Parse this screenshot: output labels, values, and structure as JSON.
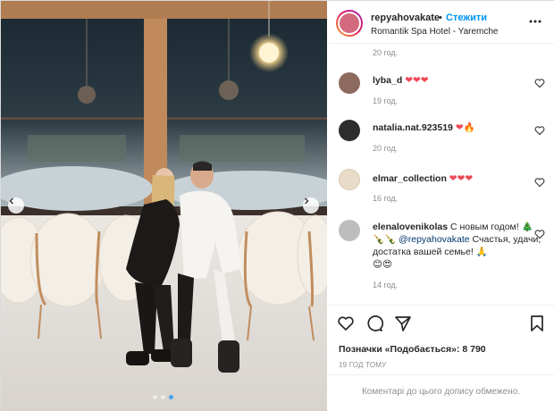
{
  "header": {
    "username": "repyahovakate",
    "separator": "•",
    "follow_label": "Стежити",
    "location": "Romantik Spa Hotel - Yaremche"
  },
  "comments": {
    "top_time": "20 год.",
    "items": [
      {
        "username": "lyba_d",
        "text": "❤❤❤",
        "time": "19 год.",
        "avatar_color": "#8c6a5e"
      },
      {
        "username": "natalia.nat.923519",
        "text": "❤🔥",
        "time": "20 год.",
        "avatar_color": "#2d2d2d"
      },
      {
        "username": "elmar_collection",
        "text": "❤❤❤",
        "time": "16 год.",
        "avatar_color": "#e8dcc9"
      },
      {
        "username": "elenalovenikolas",
        "text_1": "С новым годом!",
        "emoji_line": "🎄🍾🍾",
        "mention": "@repyahovakate",
        "text_2": "Счастья, удачи, достатка вашей семье!",
        "emoji_end": "🙏",
        "emoji_line2": "😊😍",
        "time": "14 год.",
        "avatar_color": "#bdbdbd"
      }
    ]
  },
  "actions": {
    "likes_label": "Позначки «Подобається»: 8 790",
    "age_label": "19 ГОД ТОМУ"
  },
  "footer": {
    "comments_closed": "Коментарі до цього допису обмежено."
  },
  "icons": [
    "more-options-icon",
    "like-icon",
    "comment-icon",
    "share-icon",
    "save-icon",
    "heart-small-icon",
    "carousel-prev-icon",
    "carousel-next-icon"
  ],
  "colors": {
    "link_blue": "#0095f6",
    "muted": "#8e8e8e",
    "heart_red": "#ed4956"
  }
}
